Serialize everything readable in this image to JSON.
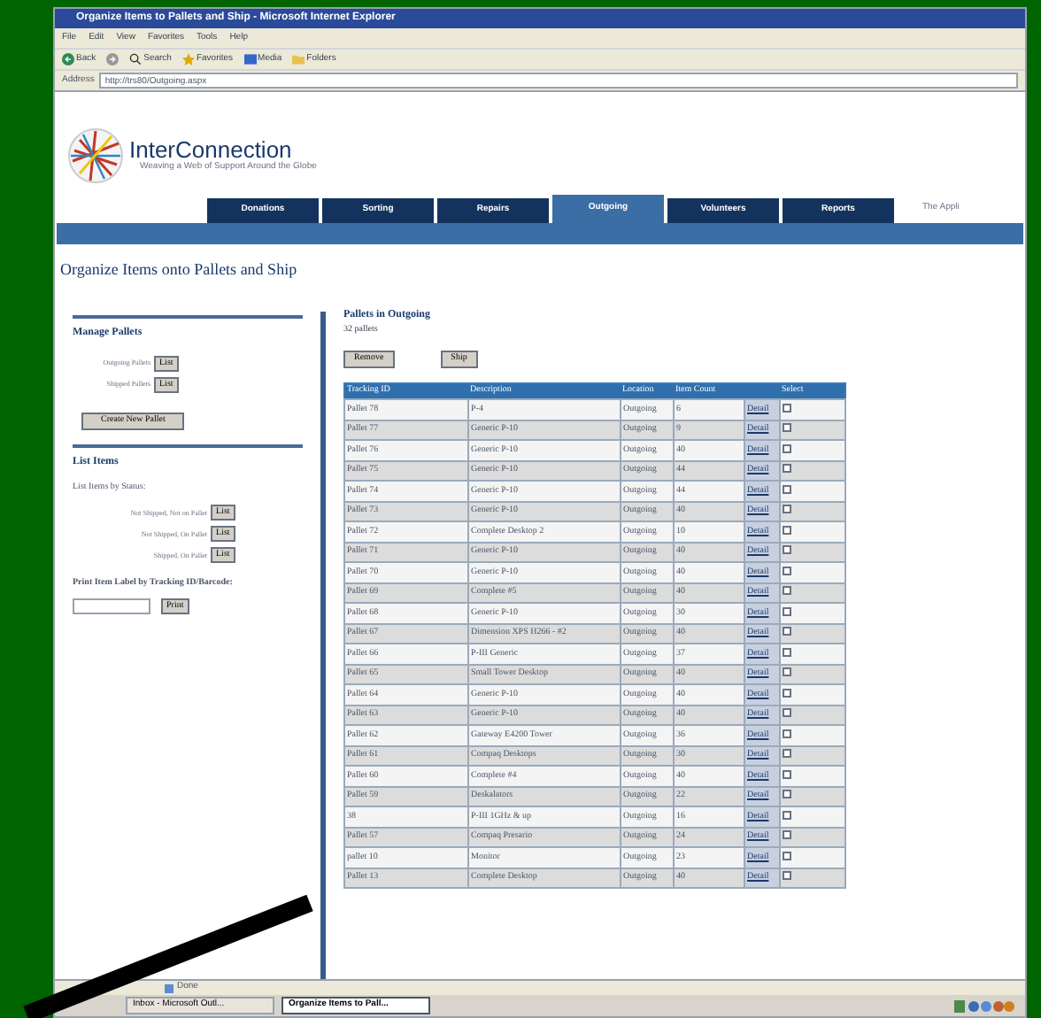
{
  "window": {
    "title": "Organize Items to Pallets and Ship - Microsoft Internet Explorer"
  },
  "menu": [
    "File",
    "Edit",
    "View",
    "Favorites",
    "Tools",
    "Help"
  ],
  "toolbar": [
    {
      "kind": "back",
      "label": "Back"
    },
    {
      "kind": "forward"
    },
    {
      "kind": "search",
      "label": "Search"
    },
    {
      "kind": "favorites",
      "label": "Favorites"
    },
    {
      "kind": "media",
      "label": "Media"
    },
    {
      "kind": "folders",
      "label": "Folders"
    }
  ],
  "address": {
    "label": "Address",
    "value": "http://trs80/Outgoing.aspx"
  },
  "site": {
    "name": "InterConnection",
    "tagline": "Weaving a Web of Support Around the Globe",
    "side_text": "The Appli"
  },
  "tabs": [
    {
      "label": "Donations",
      "selected": false
    },
    {
      "label": "Sorting",
      "selected": false
    },
    {
      "label": "Repairs",
      "selected": false
    },
    {
      "label": "Outgoing",
      "selected": true
    },
    {
      "label": "Volunteers",
      "selected": false
    },
    {
      "label": "Reports",
      "selected": false
    }
  ],
  "page_title": "Organize Items onto Pallets and Ship",
  "manage": {
    "heading": "Manage Pallets",
    "rows": [
      {
        "label": "Outgoing Pallets",
        "button": "List"
      },
      {
        "label": "Shipped Pallets",
        "button": "List"
      }
    ],
    "create_button": "Create New Pallet"
  },
  "list_items": {
    "heading": "List Items",
    "subheading": "List Items by Status:",
    "rows": [
      {
        "label": "Not Shipped, Not on Pallet",
        "button": "List"
      },
      {
        "label": "Not Shipped, On Pallet",
        "button": "List"
      },
      {
        "label": "Shipped, On Pallet",
        "button": "List"
      }
    ]
  },
  "print": {
    "label": "Print Item Label by Tracking ID/Barcode:",
    "button": "Print"
  },
  "pallets": {
    "heading": "Pallets in Outgoing",
    "count": "32 pallets",
    "buttons": [
      "Remove",
      "Ship"
    ],
    "columns": [
      "Tracking ID",
      "Description",
      "Location",
      "Item Count",
      "Select"
    ],
    "rows": [
      {
        "id": "Pallet 78",
        "description": "P-4",
        "location": "Outgoing",
        "count": "6",
        "link": "Detail",
        "selected": false
      },
      {
        "id": "Pallet 77",
        "description": "Generic P-10",
        "location": "Outgoing",
        "count": "9",
        "link": "Detail",
        "selected": false
      },
      {
        "id": "Pallet 76",
        "description": "Generic P-10",
        "location": "Outgoing",
        "count": "40",
        "link": "Detail",
        "selected": false
      },
      {
        "id": "Pallet 75",
        "description": "Generic P-10",
        "location": "Outgoing",
        "count": "44",
        "link": "Detail",
        "selected": false
      },
      {
        "id": "Pallet 74",
        "description": "Generic P-10",
        "location": "Outgoing",
        "count": "44",
        "link": "Detail",
        "selected": false
      },
      {
        "id": "Pallet 73",
        "description": "Generic P-10",
        "location": "Outgoing",
        "count": "40",
        "link": "Detail",
        "selected": false
      },
      {
        "id": "Pallet 72",
        "description": "Complete Desktop 2",
        "location": "Outgoing",
        "count": "10",
        "link": "Detail",
        "selected": false
      },
      {
        "id": "Pallet 71",
        "description": "Generic P-10",
        "location": "Outgoing",
        "count": "40",
        "link": "Detail",
        "selected": false
      },
      {
        "id": "Pallet 70",
        "description": "Generic P-10",
        "location": "Outgoing",
        "count": "40",
        "link": "Detail",
        "selected": false
      },
      {
        "id": "Pallet 69",
        "description": "Complete #5",
        "location": "Outgoing",
        "count": "40",
        "link": "Detail",
        "selected": false
      },
      {
        "id": "Pallet 68",
        "description": "Generic P-10",
        "location": "Outgoing",
        "count": "30",
        "link": "Detail",
        "selected": false
      },
      {
        "id": "Pallet 67",
        "description": "Dimension XPS H266 - #2",
        "location": "Outgoing",
        "count": "40",
        "link": "Detail",
        "selected": false
      },
      {
        "id": "Pallet 66",
        "description": "P-III Generic",
        "location": "Outgoing",
        "count": "37",
        "link": "Detail",
        "selected": false
      },
      {
        "id": "Pallet 65",
        "description": "Small Tower Desktop",
        "location": "Outgoing",
        "count": "40",
        "link": "Detail",
        "selected": false
      },
      {
        "id": "Pallet 64",
        "description": "Generic P-10",
        "location": "Outgoing",
        "count": "40",
        "link": "Detail",
        "selected": false
      },
      {
        "id": "Pallet 63",
        "description": "Generic P-10",
        "location": "Outgoing",
        "count": "40",
        "link": "Detail",
        "selected": false
      },
      {
        "id": "Pallet 62",
        "description": "Gateway E4200 Tower",
        "location": "Outgoing",
        "count": "36",
        "link": "Detail",
        "selected": false
      },
      {
        "id": "Pallet 61",
        "description": "Compaq Desktops",
        "location": "Outgoing",
        "count": "30",
        "link": "Detail",
        "selected": false
      },
      {
        "id": "Pallet 60",
        "description": "Complete #4",
        "location": "Outgoing",
        "count": "40",
        "link": "Detail",
        "selected": false
      },
      {
        "id": "Pallet 59",
        "description": "Deskalators",
        "location": "Outgoing",
        "count": "22",
        "link": "Detail",
        "selected": false
      },
      {
        "id": "38",
        "description": "P-III 1GHz & up",
        "location": "Outgoing",
        "count": "16",
        "link": "Detail",
        "selected": false
      },
      {
        "id": "Pallet 57",
        "description": "Compaq Presario",
        "location": "Outgoing",
        "count": "24",
        "link": "Detail",
        "selected": false
      },
      {
        "id": "pallet 10",
        "description": "Monitor",
        "location": "Outgoing",
        "count": "23",
        "link": "Detail",
        "selected": false
      },
      {
        "id": "Pallet 13",
        "description": "Complete Desktop",
        "location": "Outgoing",
        "count": "40",
        "link": "Detail",
        "selected": false
      }
    ]
  },
  "status_bar": "Done",
  "taskbar": [
    {
      "label": "Inbox - Microsoft Outl...",
      "selected": false
    },
    {
      "label": "Organize Items to Pall...",
      "selected": true
    }
  ]
}
